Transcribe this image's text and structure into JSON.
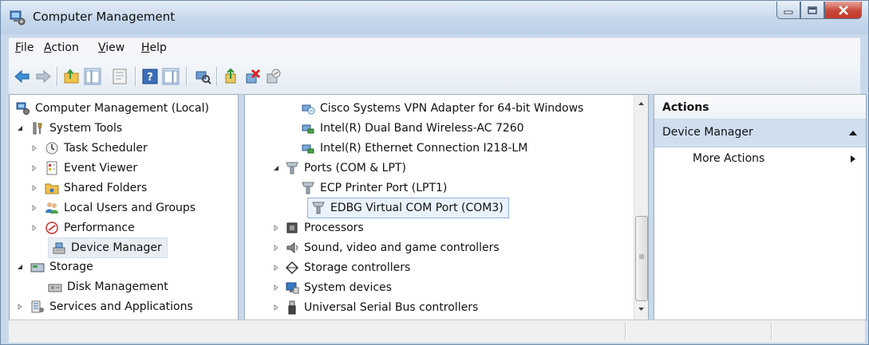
{
  "window": {
    "title": "Computer Management"
  },
  "menu": [
    {
      "label": "File",
      "key": "F",
      "rest": "ile"
    },
    {
      "label": "Action",
      "key": "A",
      "rest": "ction"
    },
    {
      "label": "View",
      "key": "V",
      "rest": "iew"
    },
    {
      "label": "Help",
      "key": "H",
      "rest": "elp"
    }
  ],
  "toolbar": {
    "icons": [
      "back-arrow-icon",
      "forward-arrow-icon",
      "up-folder-icon",
      "show-hide-console-tree-icon",
      "properties-icon",
      "help-icon",
      "show-hide-action-pane-icon",
      "scan-hardware-icon",
      "update-driver-icon",
      "uninstall-device-icon",
      "disable-device-icon"
    ]
  },
  "left_tree": {
    "root": "Computer Management (Local)",
    "system_tools": "System Tools",
    "task_scheduler": "Task Scheduler",
    "event_viewer": "Event Viewer",
    "shared_folders": "Shared Folders",
    "local_users_groups": "Local Users and Groups",
    "performance": "Performance",
    "device_manager": "Device Manager",
    "storage": "Storage",
    "disk_management": "Disk Management",
    "services_apps": "Services and Applications"
  },
  "device_tree": {
    "cisco_vpn": "Cisco Systems VPN Adapter for 64-bit Windows",
    "intel_wireless": "Intel(R) Dual Band Wireless-AC 7260",
    "intel_ethernet": "Intel(R) Ethernet Connection I218-LM",
    "ports": "Ports (COM & LPT)",
    "ecp_port": "ECP Printer Port (LPT1)",
    "edbg_port": "EDBG Virtual COM Port (COM3)",
    "processors": "Processors",
    "sound": "Sound, video and game controllers",
    "storage_controllers": "Storage controllers",
    "system_devices": "System devices",
    "usb": "Universal Serial Bus controllers"
  },
  "actions": {
    "header": "Actions",
    "section": "Device Manager",
    "more": "More Actions"
  },
  "colors": {
    "title_gradient_top": "#e3edf8",
    "selection_blue": "#cfdff0",
    "close_red": "#c8473a"
  }
}
